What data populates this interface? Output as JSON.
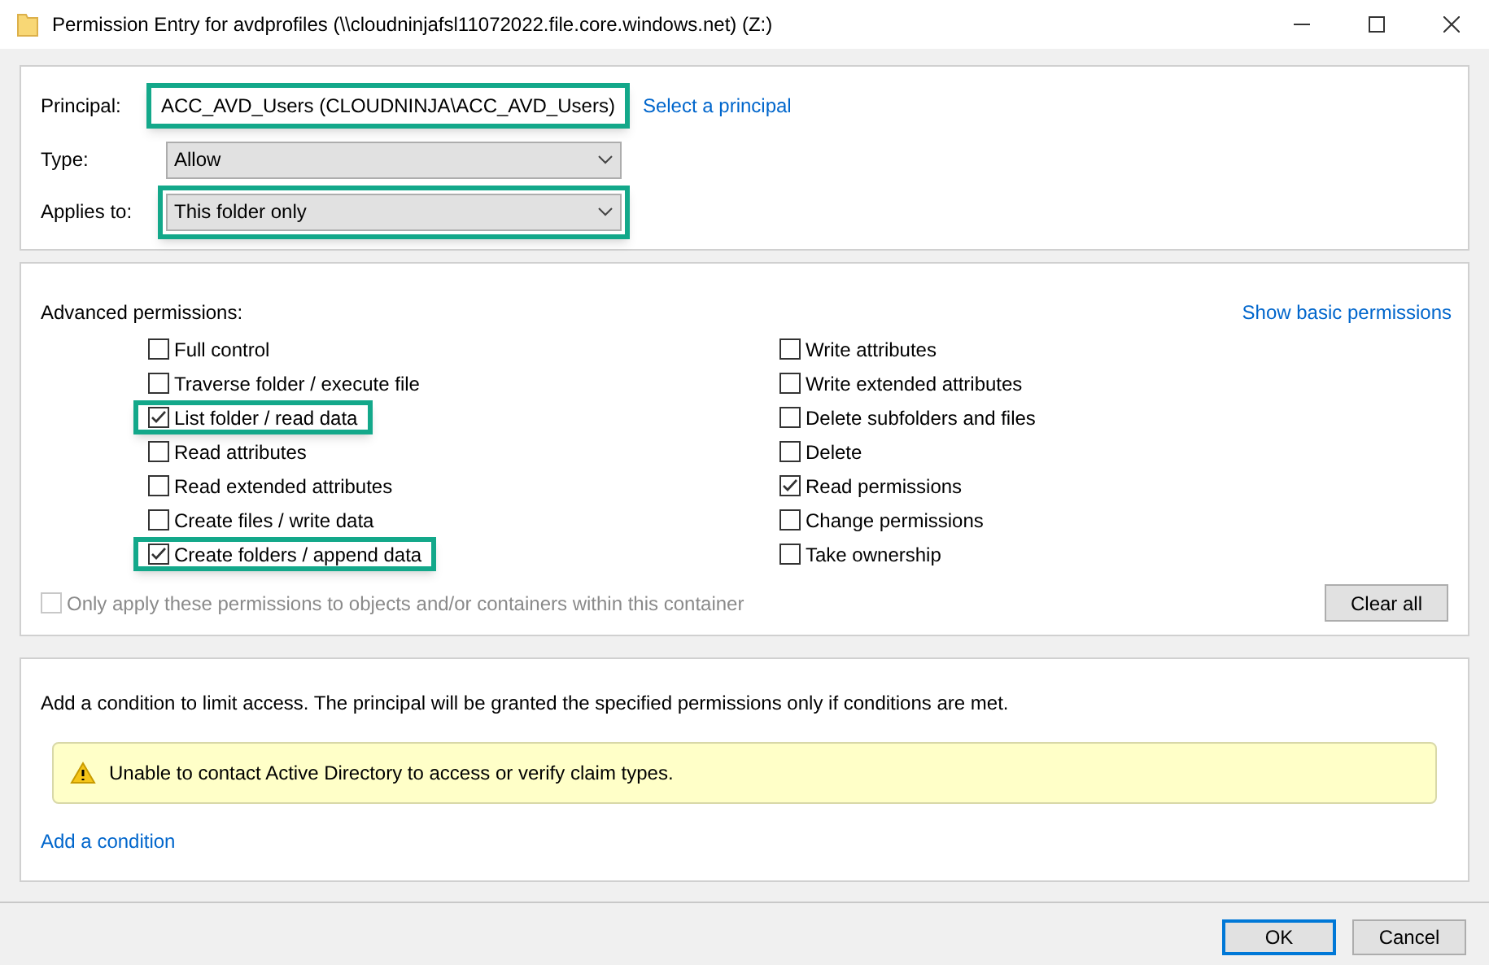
{
  "window": {
    "title": "Permission Entry for avdprofiles (\\\\cloudninjafsl11072022.file.core.windows.net) (Z:)"
  },
  "principal": {
    "label": "Principal:",
    "value": "ACC_AVD_Users (CLOUDNINJA\\ACC_AVD_Users)",
    "highlighted": true,
    "link": "Select a principal"
  },
  "type": {
    "label": "Type:",
    "value": "Allow",
    "highlighted": false
  },
  "applies_to": {
    "label": "Applies to:",
    "value": "This folder only",
    "highlighted": true
  },
  "permissions": {
    "title": "Advanced permissions:",
    "link": "Show basic permissions",
    "columns": [
      [
        {
          "label": "Full control",
          "checked": false,
          "highlighted": false
        },
        {
          "label": "Traverse folder / execute file",
          "checked": false,
          "highlighted": false
        },
        {
          "label": "List folder / read data",
          "checked": true,
          "highlighted": true
        },
        {
          "label": "Read attributes",
          "checked": false,
          "highlighted": false
        },
        {
          "label": "Read extended attributes",
          "checked": false,
          "highlighted": false
        },
        {
          "label": "Create files / write data",
          "checked": false,
          "highlighted": false
        },
        {
          "label": "Create folders / append data",
          "checked": true,
          "highlighted": true
        }
      ],
      [
        {
          "label": "Write attributes",
          "checked": false,
          "highlighted": false
        },
        {
          "label": "Write extended attributes",
          "checked": false,
          "highlighted": false
        },
        {
          "label": "Delete subfolders and files",
          "checked": false,
          "highlighted": false
        },
        {
          "label": "Delete",
          "checked": false,
          "highlighted": false
        },
        {
          "label": "Read permissions",
          "checked": true,
          "highlighted": false
        },
        {
          "label": "Change permissions",
          "checked": false,
          "highlighted": false
        },
        {
          "label": "Take ownership",
          "checked": false,
          "highlighted": false
        }
      ]
    ],
    "only_apply": {
      "label": "Only apply these permissions to objects and/or containers within this container",
      "checked": false,
      "disabled": true
    },
    "clear_button": "Clear all"
  },
  "conditions": {
    "text": "Add a condition to limit access. The principal will be granted the specified permissions only if conditions are met.",
    "warning": "Unable to contact Active Directory to access or verify claim types.",
    "link": "Add a condition"
  },
  "buttons": [
    {
      "label": "OK",
      "default": true
    },
    {
      "label": "Cancel",
      "default": false
    }
  ]
}
